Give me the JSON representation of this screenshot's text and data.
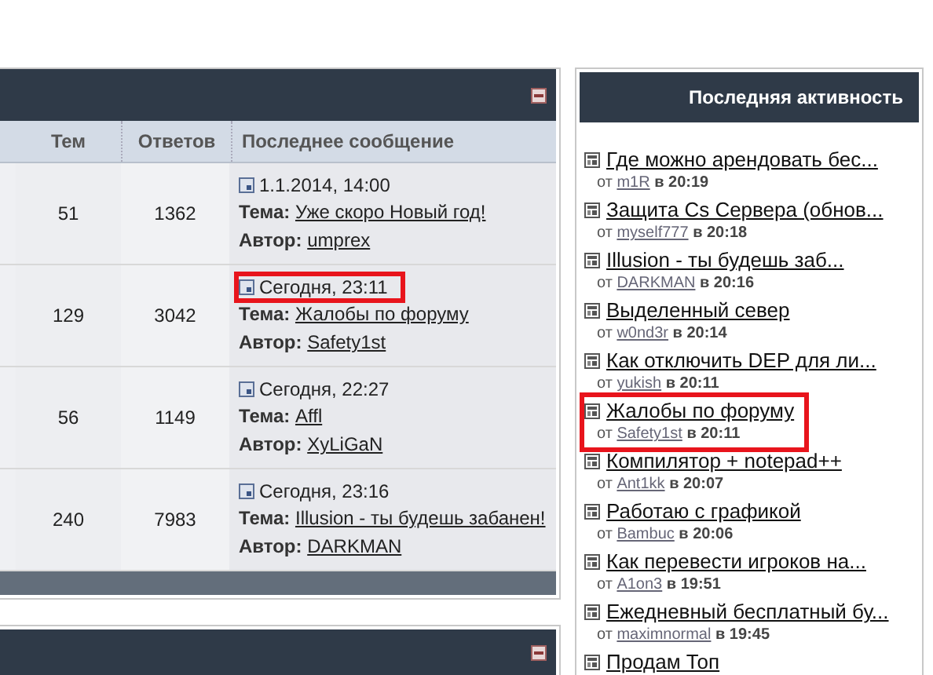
{
  "forum_table": {
    "columns": [
      "Тем",
      "Ответов",
      "Последнее сообщение"
    ],
    "rows": [
      {
        "topics": "51",
        "replies": "1362",
        "last_post": {
          "date": "1.1.2014, 14:00",
          "highlighted": false,
          "topic_label": "Тема:",
          "topic": "Уже скоро Новый год!",
          "author_label": "Автор:",
          "author": "umprex"
        }
      },
      {
        "topics": "129",
        "replies": "3042",
        "last_post": {
          "date": "Сегодня, 23:11",
          "highlighted": true,
          "topic_label": "Тема:",
          "topic": "Жалобы по форуму",
          "author_label": "Автор:",
          "author": "Safety1st"
        }
      },
      {
        "topics": "56",
        "replies": "1149",
        "last_post": {
          "date": "Сегодня, 22:27",
          "highlighted": false,
          "topic_label": "Тема:",
          "topic": "Affl",
          "author_label": "Автор:",
          "author": "XyLiGaN"
        }
      },
      {
        "topics": "240",
        "replies": "7983",
        "last_post": {
          "date": "Сегодня, 23:16",
          "highlighted": false,
          "topic_label": "Тема:",
          "topic": "Illusion - ты будешь забанен!",
          "author_label": "Автор:",
          "author": "DARKMAN"
        }
      }
    ]
  },
  "activity": {
    "title": "Последняя активность",
    "items": [
      {
        "title": "Где можно арендовать бес...",
        "from": "от",
        "user": "m1R",
        "at": "в 20:19",
        "highlighted": false
      },
      {
        "title": "Защита Cs Сервера (обнов...",
        "from": "от",
        "user": "myself777",
        "at": "в 20:18",
        "highlighted": false
      },
      {
        "title": "Illusion - ты будешь заб...",
        "from": "от",
        "user": "DARKMAN",
        "at": "в 20:16",
        "highlighted": false
      },
      {
        "title": "Выделенный север",
        "from": "от",
        "user": "w0nd3r",
        "at": "в 20:14",
        "highlighted": false
      },
      {
        "title": "Как отключить DEP для ли...",
        "from": "от",
        "user": "yukish",
        "at": "в 20:11",
        "highlighted": false
      },
      {
        "title": "Жалобы по форуму",
        "from": "от",
        "user": "Safety1st",
        "at": "в 20:11",
        "highlighted": true
      },
      {
        "title": "Компилятор + notepad++",
        "from": "от",
        "user": "Ant1kk",
        "at": "в 20:07",
        "highlighted": false
      },
      {
        "title": "Работаю с графикой",
        "from": "от",
        "user": "Bambuc",
        "at": "в 20:06",
        "highlighted": false
      },
      {
        "title": "Как перевести игроков на...",
        "from": "от",
        "user": "A1on3",
        "at": "в 19:51",
        "highlighted": false
      },
      {
        "title": "Ежедневный бесплатный бу...",
        "from": "от",
        "user": "maximnormal",
        "at": "в 19:45",
        "highlighted": false
      },
      {
        "title": "Продам Топ",
        "highlighted": false
      }
    ]
  }
}
